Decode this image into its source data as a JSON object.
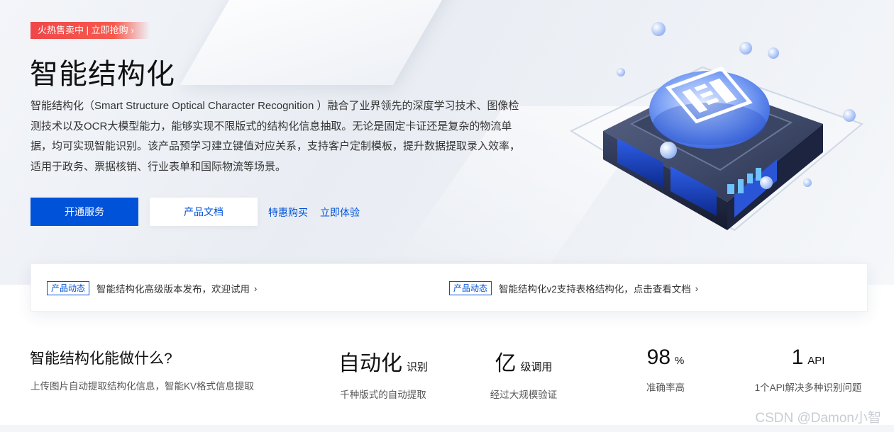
{
  "promo": {
    "label": "火热售卖中 | 立即抢购",
    "chevron": "›"
  },
  "hero": {
    "title": "智能结构化",
    "description": "智能结构化（Smart Structure Optical Character Recognition ）融合了业界领先的深度学习技术、图像检测技术以及OCR大模型能力，能够实现不限版式的结构化信息抽取。无论是固定卡证还是复杂的物流单据，均可实现智能识别。该产品预学习建立键值对应关系，支持客户定制模板，提升数据提取录入效率，适用于政务、票据核销、行业表单和国际物流等场景。",
    "primary_button": "开通服务",
    "secondary_button": "产品文档",
    "link_discount": "特惠购买",
    "link_trial": "立即体验"
  },
  "news": [
    {
      "badge": "产品动态",
      "text": "智能结构化高级版本发布，欢迎试用",
      "chevron": "›"
    },
    {
      "badge": "产品动态",
      "text": "智能结构化v2支持表格结构化，点击查看文档",
      "chevron": "›"
    }
  ],
  "capabilities": {
    "title": "智能结构化能做什么?",
    "subtitle": "上传图片自动提取结构化信息，智能KV格式信息提取",
    "stats": [
      {
        "value": "自动化",
        "unit": "识别",
        "label": "千种版式的自动提取"
      },
      {
        "value": "亿",
        "unit": "级调用",
        "label": "经过大规模验证"
      },
      {
        "value": "98",
        "unit": "%",
        "label": "准确率高"
      },
      {
        "value": "1",
        "unit": "API",
        "label": "1个API解决多种识别问题"
      }
    ]
  },
  "watermark": "CSDN @Damon小智",
  "colors": {
    "brand": "#0052d9",
    "promo": "#f0464a"
  }
}
